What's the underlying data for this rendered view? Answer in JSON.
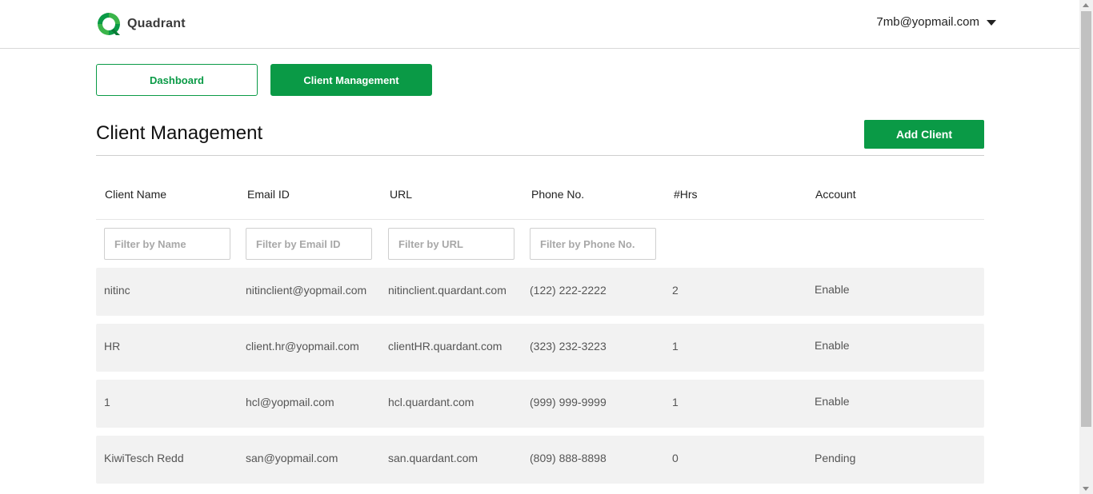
{
  "header": {
    "brand": "Quadrant",
    "user_email": "7mb@yopmail.com",
    "brand_color": "#0a9a46"
  },
  "nav": {
    "dashboard_label": "Dashboard",
    "client_management_label": "Client Management",
    "active_tab": "Client Management"
  },
  "page": {
    "title": "Client Management",
    "add_button_label": "Add Client"
  },
  "table": {
    "columns": [
      "Client Name",
      "Email ID",
      "URL",
      "Phone No.",
      "#Hrs",
      "Account"
    ],
    "filters": {
      "name_placeholder": "Filter by Name",
      "email_placeholder": "Filter by Email ID",
      "url_placeholder": "Filter by URL",
      "phone_placeholder": "Filter by Phone No."
    },
    "rows": [
      {
        "name": "nitinc",
        "email": "nitinclient@yopmail.com",
        "url": "nitinclient.quardant.com",
        "phone": "(122) 222-2222",
        "hrs": "2",
        "account": "Enable"
      },
      {
        "name": "HR",
        "email": "client.hr@yopmail.com",
        "url": "clientHR.quardant.com",
        "phone": "(323) 232-3223",
        "hrs": "1",
        "account": "Enable"
      },
      {
        "name": "1",
        "email": "hcl@yopmail.com",
        "url": "hcl.quardant.com",
        "phone": "(999) 999-9999",
        "hrs": "1",
        "account": "Enable"
      },
      {
        "name": "KiwiTesch Redd",
        "email": "san@yopmail.com",
        "url": "san.quardant.com",
        "phone": "(809) 888-8898",
        "hrs": "0",
        "account": "Pending"
      }
    ]
  }
}
